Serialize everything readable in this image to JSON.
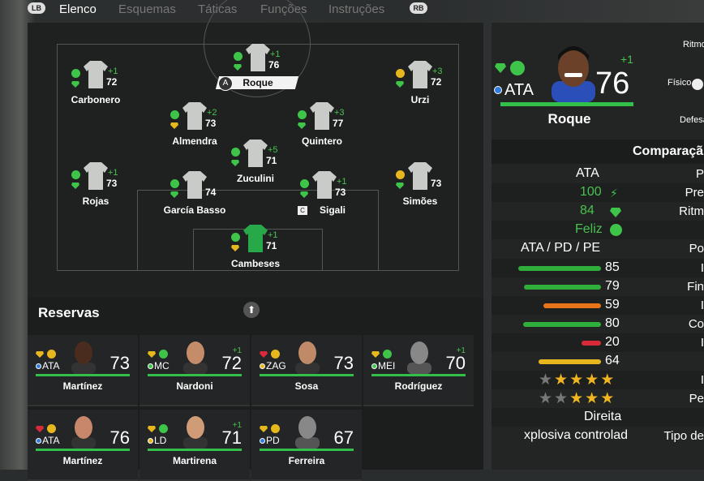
{
  "tabs": {
    "lb": "LB",
    "rb": "RB",
    "items": [
      "Elenco",
      "Esquemas",
      "Táticas",
      "Funções",
      "Instruções"
    ]
  },
  "pitch_players": [
    {
      "name": "Roque",
      "rating": "76",
      "plus": "+1",
      "badge": "A"
    },
    {
      "name": "Carbonero",
      "rating": "72",
      "plus": "+1"
    },
    {
      "name": "Urzi",
      "rating": "72",
      "plus": "+3"
    },
    {
      "name": "Almendra",
      "rating": "73",
      "plus": "+2"
    },
    {
      "name": "Quintero",
      "rating": "77",
      "plus": "+3"
    },
    {
      "name": "Zuculini",
      "rating": "71",
      "plus": "+5"
    },
    {
      "name": "Rojas",
      "rating": "73",
      "plus": "+1"
    },
    {
      "name": "García Basso",
      "rating": "74",
      "plus": ""
    },
    {
      "name": "Sigali",
      "rating": "73",
      "plus": "+1",
      "badge": "C"
    },
    {
      "name": "Simões",
      "rating": "73",
      "plus": ""
    },
    {
      "name": "Cambeses",
      "rating": "71",
      "plus": "+1"
    }
  ],
  "reserves": {
    "title": "Reservas",
    "items": [
      {
        "name": "Martínez",
        "pos": "ATA",
        "rating": "73",
        "plus": ""
      },
      {
        "name": "Nardoni",
        "pos": "MC",
        "rating": "72",
        "plus": "+1"
      },
      {
        "name": "Sosa",
        "pos": "ZAG",
        "rating": "73",
        "plus": ""
      },
      {
        "name": "Rodríguez",
        "pos": "MEI",
        "rating": "70",
        "plus": "+1"
      },
      {
        "name": "Martínez",
        "pos": "ATA",
        "rating": "76",
        "plus": ""
      },
      {
        "name": "Martirena",
        "pos": "LD",
        "rating": "71",
        "plus": "+1"
      },
      {
        "name": "Ferreira",
        "pos": "PD",
        "rating": "67",
        "plus": ""
      }
    ]
  },
  "detail": {
    "name": "Roque",
    "pos": "ATA",
    "rating": "76",
    "plus": "+1",
    "side_labels": [
      "Ritmo",
      "Físico",
      "Defesa"
    ],
    "comparison_title": "Comparaçã",
    "rows": [
      {
        "value": "ATA",
        "label": "P"
      },
      {
        "value": "100",
        "label": "Pre"
      },
      {
        "value": "84",
        "label": "Ritm"
      },
      {
        "value": "Feliz",
        "label": ""
      },
      {
        "value": "ATA / PD / PE",
        "label": "Po"
      },
      {
        "value": "85",
        "label": "I",
        "bar": 0.85,
        "color": "#2fae3b"
      },
      {
        "value": "79",
        "label": "Fin",
        "bar": 0.79,
        "color": "#2fae3b"
      },
      {
        "value": "59",
        "label": "I",
        "bar": 0.59,
        "color": "#e8741a"
      },
      {
        "value": "80",
        "label": "Co",
        "bar": 0.8,
        "color": "#2fae3b"
      },
      {
        "value": "20",
        "label": "I",
        "bar": 0.2,
        "color": "#d92a3a"
      },
      {
        "value": "64",
        "label": "",
        "bar": 0.64,
        "color": "#e6b81e"
      },
      {
        "value": "",
        "label": "I",
        "stars": 4
      },
      {
        "value": "",
        "label": "Pe",
        "stars": 3
      },
      {
        "value": "Direita",
        "label": ""
      },
      {
        "value": "xplosiva controlad",
        "label": "Tipo de"
      }
    ]
  }
}
